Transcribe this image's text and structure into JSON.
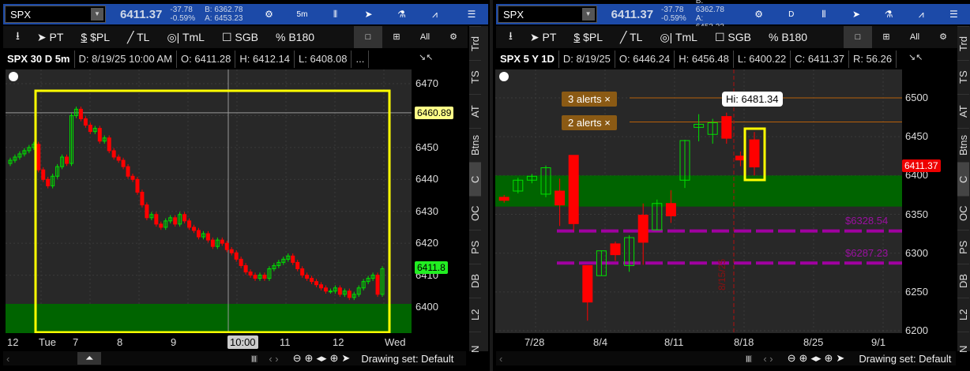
{
  "left": {
    "header": {
      "symbol": "SPX",
      "last": "6411.37",
      "change": "-37.78",
      "change_pct": "-0.59%",
      "bid": "B: 6362.78",
      "ask": "A: 6453.23",
      "aggregation": "5m"
    },
    "toolbar": [
      "PT",
      "$PL",
      "TL",
      "TmL",
      "SGB",
      "B180"
    ],
    "info": {
      "title": "SPX 30 D 5m",
      "date": "D: 8/19/25 10:00 AM",
      "open": "O: 6411.28",
      "high": "H: 6412.14",
      "low": "L: 6408.08",
      "more": "..."
    },
    "price_labels": [
      "6470",
      "6460",
      "6450",
      "6440",
      "6430",
      "6420",
      "6410",
      "6400"
    ],
    "crosshair_price": "6460.89",
    "last_price_label": "6411.8",
    "crosshair_time": "10:00",
    "time_labels": [
      "12",
      "Tue",
      "7",
      "8",
      "9",
      "11",
      "12",
      "Wed"
    ],
    "drawing_set": "Drawing set: Default",
    "closes": [
      6446,
      6447,
      6448,
      6449,
      6450,
      6451,
      6443,
      6440,
      6438,
      6441,
      6444,
      6447,
      6445,
      6460,
      6462,
      6459,
      6457,
      6455,
      6456,
      6452,
      6453,
      6449,
      6447,
      6446,
      6444,
      6441,
      6440,
      6436,
      6432,
      6428,
      6429,
      6426,
      6425,
      6427,
      6428,
      6426,
      6429,
      6427,
      6425,
      6424,
      6422,
      6423,
      6421,
      6419,
      6421,
      6420,
      6418,
      6417,
      6415,
      6413,
      6411,
      6410,
      6409,
      6410,
      6409,
      6412,
      6413,
      6414,
      6415,
      6416,
      6414,
      6412,
      6410,
      6409,
      6408,
      6407,
      6406,
      6405,
      6405,
      6406,
      6404,
      6405,
      6403,
      6404,
      6406,
      6408,
      6409,
      6410,
      6404,
      6412
    ]
  },
  "right": {
    "header": {
      "symbol": "SPX",
      "last": "6411.37",
      "change": "-37.78",
      "change_pct": "-0.59%",
      "bid": "B: 6362.78",
      "ask": "A: 6453.23",
      "aggregation": "D"
    },
    "toolbar": [
      "PT",
      "$PL",
      "TL",
      "TmL",
      "SGB",
      "B180"
    ],
    "info": {
      "title": "SPX 5 Y 1D",
      "date": "D: 8/19/25",
      "open": "O: 6446.24",
      "high": "H: 6456.48",
      "low": "L: 6400.22",
      "close": "C: 6411.37",
      "rsi": "R: 56.26"
    },
    "price_labels": [
      "6500",
      "6450",
      "6400",
      "6350",
      "6300",
      "6250",
      "6200"
    ],
    "last_price_label": "6411.37",
    "alerts": [
      "3 alerts ×",
      "2 alerts ×"
    ],
    "hi_label": "Hi: 6481.34",
    "levels": [
      "$6328.54",
      "$6287.23"
    ],
    "vline_label": "8/15/25",
    "time_labels": [
      "7/28",
      "8/4",
      "8/11",
      "8/18",
      "8/25",
      "9/1"
    ],
    "drawing_set": "Drawing set: Default",
    "candles": [
      [
        6372,
        6375,
        6365,
        6368
      ],
      [
        6380,
        6397,
        6377,
        6394
      ],
      [
        6394,
        6402,
        6390,
        6399
      ],
      [
        6376,
        6413,
        6372,
        6410
      ],
      [
        6380,
        6396,
        6335,
        6362
      ],
      [
        6426,
        6426,
        6329,
        6338
      ],
      [
        6284,
        6284,
        6213,
        6237
      ],
      [
        6271,
        6303,
        6271,
        6303
      ],
      [
        6312,
        6315,
        6290,
        6298
      ],
      [
        6284,
        6323,
        6276,
        6320
      ],
      [
        6349,
        6364,
        6285,
        6314
      ],
      [
        6330,
        6369,
        6330,
        6364
      ],
      [
        6364,
        6381,
        6339,
        6348
      ],
      [
        6394,
        6446,
        6384,
        6445
      ],
      [
        6462,
        6479,
        6444,
        6466
      ],
      [
        6453,
        6473,
        6441,
        6468
      ],
      [
        6476,
        6481,
        6441,
        6448
      ],
      [
        6425,
        6431,
        6412,
        6420
      ],
      [
        6446,
        6456,
        6400,
        6411
      ]
    ]
  },
  "tabs": [
    "Trd",
    "TS",
    "AT",
    "Btns",
    "C",
    "OC",
    "PS",
    "DB",
    "L2",
    "N"
  ],
  "colors": {
    "up": "#00e000",
    "down": "#ff0000",
    "zone": "#006400",
    "highlight": "#ffff00",
    "alert": "#8b5a14",
    "level": "#a000a0"
  }
}
